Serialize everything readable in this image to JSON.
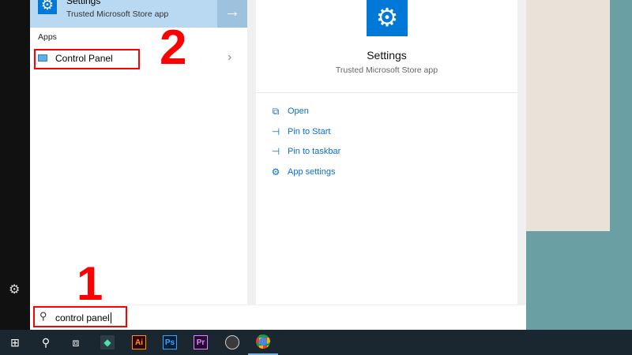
{
  "best_match": {
    "title": "Settings",
    "subtitle": "Trusted Microsoft Store app",
    "icon": "gear-icon"
  },
  "apps": {
    "header": "Apps",
    "items": [
      {
        "label": "Control Panel",
        "icon": "control-panel-icon"
      }
    ]
  },
  "detail": {
    "title": "Settings",
    "subtitle": "Trusted Microsoft Store app",
    "actions": [
      {
        "label": "Open",
        "icon": "open-icon"
      },
      {
        "label": "Pin to Start",
        "icon": "pin-icon"
      },
      {
        "label": "Pin to taskbar",
        "icon": "pin-icon"
      },
      {
        "label": "App settings",
        "icon": "gear-icon"
      }
    ]
  },
  "search": {
    "value": "control panel"
  },
  "annotations": {
    "step1": "1",
    "step2": "2",
    "color": "#ff0000"
  },
  "taskbar": {
    "items": [
      {
        "name": "start"
      },
      {
        "name": "search"
      },
      {
        "name": "task-view"
      },
      {
        "name": "filmora"
      },
      {
        "name": "illustrator",
        "label": "Ai"
      },
      {
        "name": "photoshop",
        "label": "Ps"
      },
      {
        "name": "premiere",
        "label": "Pr"
      },
      {
        "name": "obs"
      },
      {
        "name": "chrome"
      }
    ]
  },
  "colors": {
    "accent": "#0078d7",
    "link": "#0a6ed1",
    "taskbar": "#1b2730",
    "desktop": "#6aa0a4"
  }
}
